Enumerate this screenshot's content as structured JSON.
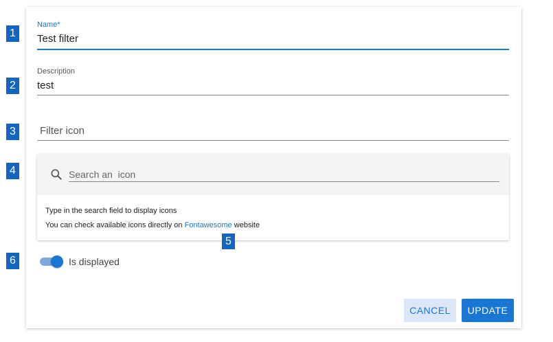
{
  "badges": [
    "1",
    "2",
    "3",
    "4",
    "5",
    "6"
  ],
  "form": {
    "name_label": "Name*",
    "name_value": "Test filter",
    "description_label": "Description",
    "description_value": "test",
    "filter_icon_placeholder": "Filter icon"
  },
  "icon_search": {
    "placeholder": "Search an  icon",
    "hint_line1": "Type in the search field to display icons",
    "hint_line2_prefix": "You can check available icons directly on",
    "hint_link": "Fontawesome",
    "hint_line2_suffix": "website"
  },
  "toggle": {
    "label": "Is displayed",
    "checked": true
  },
  "actions": {
    "cancel_label": "CANCEL",
    "update_label": "UPDATE"
  },
  "colors": {
    "primary": "#1976d2",
    "badge": "#1565c0"
  }
}
